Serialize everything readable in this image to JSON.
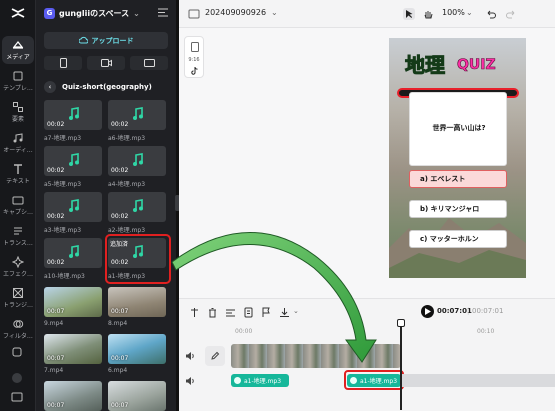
{
  "rail": {
    "items": [
      {
        "label": "メディア",
        "icon": "media-icon",
        "active": true
      },
      {
        "label": "テンプレ…",
        "icon": "template-icon"
      },
      {
        "label": "要素",
        "icon": "elements-icon"
      },
      {
        "label": "オーディ…",
        "icon": "audio-icon"
      },
      {
        "label": "テキスト",
        "icon": "text-icon"
      },
      {
        "label": "キャプシ…",
        "icon": "captions-icon"
      },
      {
        "label": "トランス…",
        "icon": "transcript-icon"
      },
      {
        "label": "エフェク…",
        "icon": "effects-icon"
      },
      {
        "label": "トランジ…",
        "icon": "transition-icon"
      },
      {
        "label": "フィルタ…",
        "icon": "filter-icon"
      }
    ]
  },
  "panel": {
    "workspace_initial": "G",
    "workspace_name": "gungliiのスペース",
    "upload_label": "アップロード",
    "folder_name": "Quiz-short(geography)",
    "audio_items": [
      {
        "duration": "00:02",
        "name": "a7-地理.mp3"
      },
      {
        "duration": "00:02",
        "name": "a6-地理.mp3"
      },
      {
        "duration": "00:02",
        "name": "a5-地理.mp3"
      },
      {
        "duration": "00:02",
        "name": "a4-地理.mp3"
      },
      {
        "duration": "00:02",
        "name": "a3-地理.mp3"
      },
      {
        "duration": "00:02",
        "name": "a2-地理.mp3"
      },
      {
        "duration": "00:02",
        "name": "a10-地理.mp3"
      },
      {
        "duration": "00:02",
        "name": "a1-地理.mp3",
        "tag": "追加済"
      }
    ],
    "video_items": [
      {
        "duration": "00:07",
        "name": "9.mp4"
      },
      {
        "duration": "00:07",
        "name": "8.mp4"
      },
      {
        "duration": "00:07",
        "name": "7.mp4"
      },
      {
        "duration": "00:07",
        "name": "6.mp4"
      },
      {
        "duration": "00:07",
        "name": ""
      },
      {
        "duration": "00:07",
        "name": ""
      }
    ]
  },
  "topbar": {
    "project_name": "20240909092​6",
    "zoom": "100%"
  },
  "stage": {
    "ratio_label": "9:16"
  },
  "preview": {
    "title_kanji": "地理",
    "title_quiz": "QUIZ",
    "question": "世界一高い山は?",
    "options": [
      {
        "text": "a) エベレスト",
        "selected": true
      },
      {
        "text": "b) キリマンジャロ",
        "selected": false
      },
      {
        "text": "c) マッターホルン",
        "selected": false
      }
    ]
  },
  "timeline": {
    "current_time": "00:07:01",
    "total_time": "00:07:01",
    "ruler": [
      "00:00",
      "00:10"
    ],
    "audio_clips": [
      "a1-地理.mp3",
      "a1-地理.mp3"
    ]
  },
  "colors": {
    "accent_cyan": "#6de0ea",
    "audio_green": "#16b79a",
    "highlight_red": "#e02020"
  }
}
